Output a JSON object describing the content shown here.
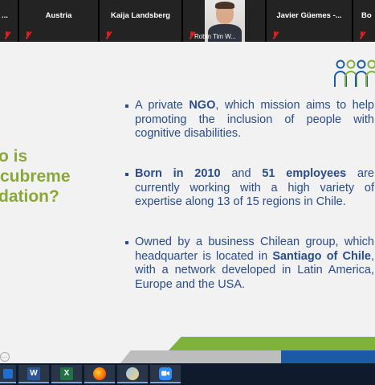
{
  "participants": [
    {
      "name": "...",
      "muted": true
    },
    {
      "name": "Austria",
      "muted": true
    },
    {
      "name": "Kaija Landsberg",
      "muted": true
    },
    {
      "name": "Robin Tim W...",
      "muted": true,
      "video": true
    },
    {
      "name": "Javier Güemes -...",
      "muted": true
    },
    {
      "name": "Bo",
      "muted": true
    }
  ],
  "slide": {
    "question_lines": [
      "o is",
      "cubreme",
      "dation?"
    ],
    "bullets": [
      {
        "parts": [
          "A private ",
          "NGO",
          ", which mission aims to help promoting the inclusion of people with cognitive disabilities."
        ]
      },
      {
        "parts": [
          "Born in 2010",
          " and ",
          "51 employees",
          " are currently working with a high variety of expertise along 13 of 15 regions in Chile."
        ]
      },
      {
        "parts": [
          "Owned by a business Chilean group, which headquarter is located in ",
          "Santiago of Chile",
          ", with a network developed in Latin America, Europe and the USA."
        ]
      }
    ],
    "accent_green": "#8aa83a",
    "text_blue": "#2a4c8a",
    "more_button": "..."
  },
  "taskbar": {
    "apps": [
      {
        "name": "start",
        "icon": "windows-icon"
      },
      {
        "name": "Word",
        "label": "W",
        "color": "#2b579a"
      },
      {
        "name": "Excel",
        "label": "X",
        "color": "#217346"
      },
      {
        "name": "Firefox",
        "icon": "firefox-icon"
      },
      {
        "name": "Paint",
        "icon": "paint-icon"
      },
      {
        "name": "Zoom",
        "icon": "zoom-icon"
      }
    ]
  }
}
